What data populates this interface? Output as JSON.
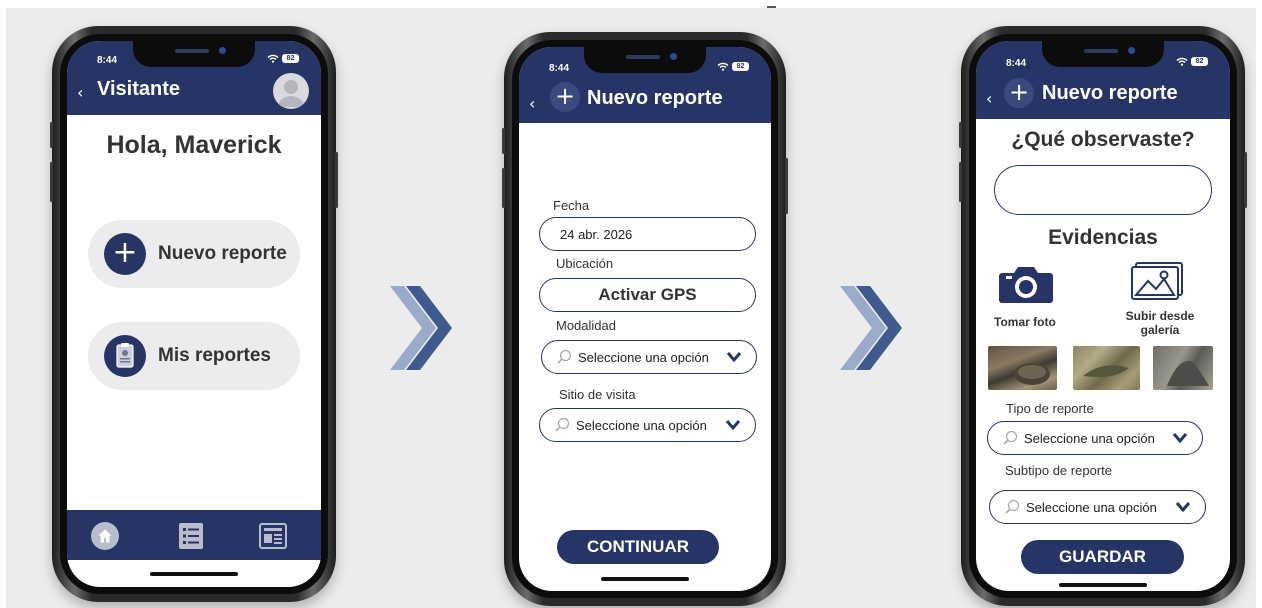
{
  "screen1": {
    "status_time": "8:44",
    "battery": "82",
    "back_glyph": "‹",
    "title": "Visitante",
    "greeting": "Hola, Maverick",
    "menu": [
      {
        "label": "Nuevo reporte",
        "icon": "plus-icon"
      },
      {
        "label": "Mis reportes",
        "icon": "clipboard-icon"
      }
    ],
    "bottom_nav": [
      {
        "icon": "home-icon",
        "active": true
      },
      {
        "icon": "list-icon"
      },
      {
        "icon": "newspaper-icon"
      }
    ]
  },
  "screen2": {
    "status_time": "8:44",
    "battery": "82",
    "back_glyph": "‹",
    "plus_glyph": "+",
    "title": "Nuevo reporte",
    "fecha_label": "Fecha",
    "fecha_value": "24 abr. 2026",
    "ubicacion_label": "Ubicación",
    "gps_button": "Activar GPS",
    "modalidad_label": "Modalidad",
    "modalidad_placeholder": "Seleccione una opción",
    "sitio_label": "Sitio de visita",
    "sitio_placeholder": "Seleccione una opción",
    "continue_button": "CONTINUAR"
  },
  "screen3": {
    "status_time": "8:44",
    "battery": "82",
    "back_glyph": "‹",
    "plus_glyph": "+",
    "title": "Nuevo reporte",
    "question": "¿Qué observaste?",
    "observation_value": "",
    "evidence_title": "Evidencias",
    "take_photo": "Tomar foto",
    "upload_gallery": "Subir desde galería",
    "tipo_label": "Tipo de reporte",
    "tipo_placeholder": "Seleccione una opción",
    "subtipo_label": "Subtipo de reporte",
    "subtipo_placeholder": "Seleccione una opción",
    "save_button": "GUARDAR"
  },
  "colors": {
    "primary": "#263566",
    "arrow_dark": "#3f5a8c",
    "arrow_light": "#9aaacb",
    "pill_bg": "#ececef"
  }
}
